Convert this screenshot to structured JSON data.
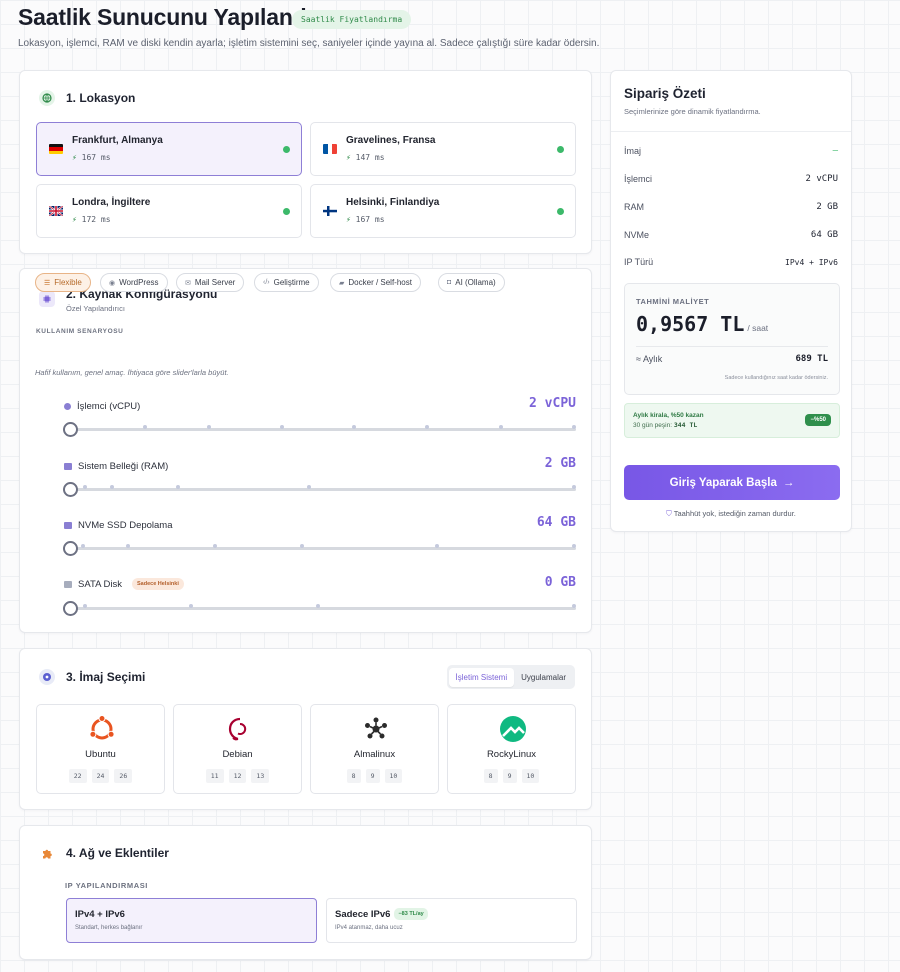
{
  "header": {
    "title": "Saatlik Sunucunu Yapılandır",
    "badge": "Saatlik Fiyatlandırma",
    "subtitle": "Lokasyon, işlemci, RAM ve diski kendin ayarla; işletim sistemini seç, saniyeler içinde yayına al. Sadece çalıştığı süre kadar ödersin."
  },
  "location": {
    "title": "1. Lokasyon",
    "items": [
      {
        "name": "Frankfurt, Almanya",
        "ping": "167 ms",
        "selected": true
      },
      {
        "name": "Gravelines, Fransa",
        "ping": "147 ms",
        "selected": false
      },
      {
        "name": "Londra, İngiltere",
        "ping": "172 ms",
        "selected": false
      },
      {
        "name": "Helsinki, Finlandiya",
        "ping": "167 ms",
        "selected": false
      }
    ]
  },
  "resources": {
    "title": "2. Kaynak Konfigürasyonu",
    "subtitle": "Özel Yapılandırıcı",
    "scenario_label": "KULLANIM SENARYOSU",
    "scenarios": [
      "Flexible",
      "WordPress",
      "Mail Server",
      "Geliştirme",
      "Docker / Self-host",
      "AI (Ollama)"
    ],
    "selected_scenario": "Flexible",
    "hint": "Hafif kullanım, genel amaç. İhtiyaca göre slider'larla büyüt.",
    "sliders": [
      {
        "label": "İşlemci (vCPU)",
        "value": "2 vCPU",
        "level": 0
      },
      {
        "label": "Sistem Belleği (RAM)",
        "value": "2 GB",
        "level": 0
      },
      {
        "label": "NVMe SSD Depolama",
        "value": "64 GB",
        "level": 0
      },
      {
        "label": "SATA Disk",
        "badge": "Sadece Helsinki",
        "value": "0 GB",
        "level": 0
      }
    ]
  },
  "image": {
    "title": "3. İmaj Seçimi",
    "tabs": [
      "İşletim Sistemi",
      "Uygulamalar"
    ],
    "active_tab": "İşletim Sistemi",
    "os": [
      {
        "name": "Ubuntu",
        "versions": [
          "22",
          "24",
          "26"
        ],
        "color": "#e95420"
      },
      {
        "name": "Debian",
        "versions": [
          "11",
          "12",
          "13"
        ],
        "color": "#a80030"
      },
      {
        "name": "Almalinux",
        "versions": [
          "8",
          "9",
          "10"
        ],
        "color": "#2b2b2b"
      },
      {
        "name": "RockyLinux",
        "versions": [
          "8",
          "9",
          "10"
        ],
        "color": "#10b981"
      }
    ]
  },
  "network": {
    "title": "4. Ağ ve Eklentiler",
    "ip_label": "IP YAPILANDIRMASI",
    "options": [
      {
        "title": "IPv4 + IPv6",
        "desc": "Standart, herkes bağlanır",
        "selected": true
      },
      {
        "title": "Sadece IPv6",
        "badge": "−83 TL/ay",
        "desc": "IPv4 atanmaz, daha ucuz",
        "selected": false
      }
    ]
  },
  "summary": {
    "title": "Sipariş Özeti",
    "subtitle": "Seçimlerinize göre dinamik fiyatlandırma.",
    "rows": [
      {
        "label": "İmaj",
        "value": "–"
      },
      {
        "label": "İşlemci",
        "value": "2 vCPU"
      },
      {
        "label": "RAM",
        "value": "2 GB"
      },
      {
        "label": "NVMe",
        "value": "64 GB"
      },
      {
        "label": "IP Türü",
        "value": "IPv4 + IPv6"
      }
    ],
    "cost_label": "TAHMİNİ MALİYET",
    "price": "0,9567 TL",
    "price_unit": "/ saat",
    "monthly_label": "≈ Aylık",
    "monthly_value": "689 TL",
    "note": "Sadece kullandığınız saat kadar ödersiniz.",
    "promo_title": "Aylık kirala, %50 kazan",
    "promo_text": "30 gün peşin:",
    "promo_amount": "344 TL",
    "promo_badge": "−%50",
    "cta": "Giriş Yaparak Başla",
    "cta_arrow": "→",
    "guarantee": "Taahhüt yok, istediğin zaman durdur."
  },
  "colors": {
    "accent": "#7b63d8",
    "green": "#3cb96a",
    "orange": "#e8b487"
  }
}
